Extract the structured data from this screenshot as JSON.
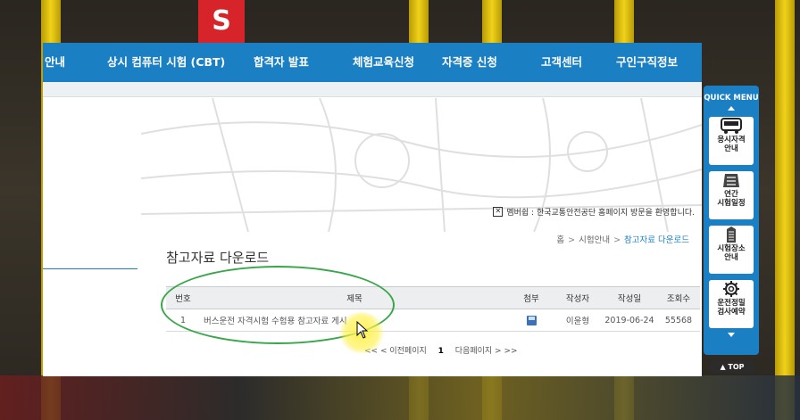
{
  "nav": {
    "items": [
      "안내",
      "상시 컴퓨터 시험 (CBT)",
      "합격자 발표",
      "체험교육신청",
      "자격증 신청",
      "고객센터",
      "구인구직정보"
    ]
  },
  "welcome": "멤버쉽 : 한국교통안전공단 홈페이지 방문을 환영합니다.",
  "breadcrumb": {
    "home": "홈",
    "section": "시험안내",
    "current": "참고자료 다운로드",
    "separator": ">"
  },
  "page_title": "참고자료 다운로드",
  "table": {
    "headers": {
      "no": "번호",
      "title": "제목",
      "attach": "첨부",
      "author": "작성자",
      "date": "작성일",
      "views": "조회수"
    },
    "rows": [
      {
        "no": "1",
        "title": "버스운전 자격시험 수험용 참고자료 게시",
        "author": "이윤형",
        "date": "2019-06-24",
        "views": "55568"
      }
    ]
  },
  "pager": {
    "first": "<<",
    "prev": "< 이전페이지",
    "current": "1",
    "next": "다음페이지 >",
    "last": ">>"
  },
  "quick_menu": {
    "title": "QUICK MENU",
    "items": [
      {
        "icon": "bus-icon",
        "label": "응시자격\n안내"
      },
      {
        "icon": "calendar-icon",
        "label": "연간\n시험일정"
      },
      {
        "icon": "building-icon",
        "label": "시험장소\n안내"
      },
      {
        "icon": "gear-icon",
        "label": "운전정밀\n검사예약"
      }
    ],
    "top_label": "▲ TOP"
  },
  "background": {
    "sign_letter": "S"
  },
  "colors": {
    "nav_blue": "#1b7fc4",
    "highlight_green": "#3aa64a",
    "cursor_glow": "#fff046"
  }
}
